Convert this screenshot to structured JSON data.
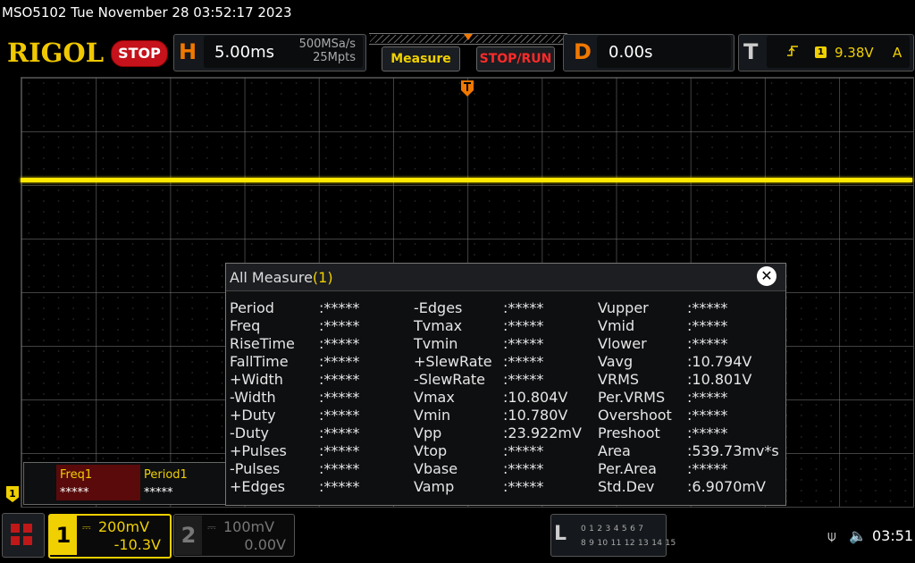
{
  "status_line": "MSO5102  Tue November 28 03:52:17 2023",
  "toolbar": {
    "logo": "RIGOL",
    "run_state": "STOP",
    "horizontal": {
      "letter": "H",
      "timebase": "5.00ms",
      "sample_rate": "500MSa/s",
      "memory_depth": "25Mpts"
    },
    "measure_label": "Measure",
    "stoprun_label": "STOP/RUN",
    "delay": {
      "letter": "D",
      "value": "0.00s"
    },
    "trigger": {
      "letter": "T",
      "edge_icon": "rising-edge-icon",
      "source": "1",
      "level": "9.38V",
      "mode": "A"
    }
  },
  "waveform": {
    "ch1_marker": "1"
  },
  "all_measure": {
    "title": "All Measure",
    "source": "(1)",
    "close_glyph": "✕",
    "columns": [
      [
        {
          "name": "Period",
          "value": ":*****"
        },
        {
          "name": "Freq",
          "value": ":*****"
        },
        {
          "name": "RiseTime",
          "value": ":*****"
        },
        {
          "name": "FallTime",
          "value": ":*****"
        },
        {
          "name": "+Width",
          "value": ":*****"
        },
        {
          "name": "-Width",
          "value": ":*****"
        },
        {
          "name": "+Duty",
          "value": ":*****"
        },
        {
          "name": "-Duty",
          "value": ":*****"
        },
        {
          "name": "+Pulses",
          "value": ":*****"
        },
        {
          "name": "-Pulses",
          "value": ":*****"
        },
        {
          "name": "+Edges",
          "value": ":*****"
        }
      ],
      [
        {
          "name": "-Edges",
          "value": ":*****"
        },
        {
          "name": "Tvmax",
          "value": ":*****"
        },
        {
          "name": "Tvmin",
          "value": ":*****"
        },
        {
          "name": "+SlewRate",
          "value": ":*****"
        },
        {
          "name": "-SlewRate",
          "value": ":*****"
        },
        {
          "name": "Vmax",
          "value": ":10.804V"
        },
        {
          "name": "Vmin",
          "value": ":10.780V"
        },
        {
          "name": "Vpp",
          "value": ":23.922mV"
        },
        {
          "name": "Vtop",
          "value": ":*****"
        },
        {
          "name": "Vbase",
          "value": ":*****"
        },
        {
          "name": "Vamp",
          "value": ":*****"
        }
      ],
      [
        {
          "name": "Vupper",
          "value": ":*****"
        },
        {
          "name": "Vmid",
          "value": ":*****"
        },
        {
          "name": "Vlower",
          "value": ":*****"
        },
        {
          "name": "Vavg",
          "value": ":10.794V"
        },
        {
          "name": "VRMS",
          "value": ":10.801V"
        },
        {
          "name": "Per.VRMS",
          "value": ":*****"
        },
        {
          "name": "Overshoot",
          "value": ":*****"
        },
        {
          "name": "Preshoot",
          "value": ":*****"
        },
        {
          "name": "Area",
          "value": ":539.73mv*s"
        },
        {
          "name": "Per.Area",
          "value": ":*****"
        },
        {
          "name": "Std.Dev",
          "value": ":6.9070mV"
        }
      ]
    ]
  },
  "quick_measure": {
    "freq": {
      "label": "Freq1",
      "value": "*****"
    },
    "period": {
      "label": "Period1",
      "value": "*****"
    }
  },
  "bottom_bar": {
    "ch1": {
      "number": "1",
      "coupling_glyph": "⎓",
      "scale": "200mV",
      "offset": "-10.3V"
    },
    "ch2": {
      "number": "2",
      "coupling_glyph": "⎓",
      "scale": "100mV",
      "offset": "0.00V"
    },
    "la": {
      "letter": "L",
      "row1": "0 1 2 3  4 5 6 7",
      "row2": "8 9 10 11 12 13 14 15"
    },
    "usb_glyph": "⍦",
    "speaker_glyph": "🔈",
    "time": "03:51"
  },
  "colors": {
    "ch1": "#f0d000",
    "accent_orange": "#f07800",
    "stop_red": "#c5121b",
    "background": "#000000"
  }
}
